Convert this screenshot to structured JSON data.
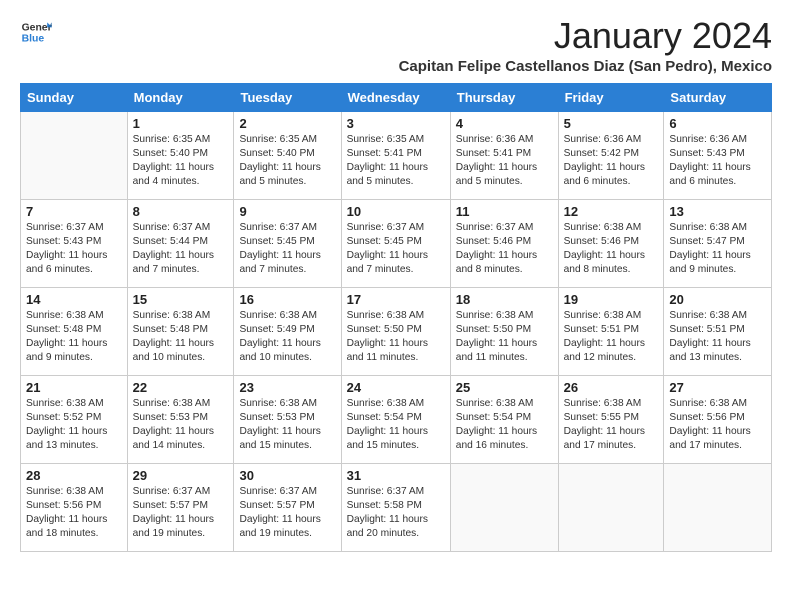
{
  "header": {
    "logo_line1": "General",
    "logo_line2": "Blue",
    "main_title": "January 2024",
    "subtitle": "Capitan Felipe Castellanos Diaz (San Pedro), Mexico"
  },
  "calendar": {
    "days_of_week": [
      "Sunday",
      "Monday",
      "Tuesday",
      "Wednesday",
      "Thursday",
      "Friday",
      "Saturday"
    ],
    "weeks": [
      [
        {
          "day": "",
          "info": ""
        },
        {
          "day": "1",
          "info": "Sunrise: 6:35 AM\nSunset: 5:40 PM\nDaylight: 11 hours\nand 4 minutes."
        },
        {
          "day": "2",
          "info": "Sunrise: 6:35 AM\nSunset: 5:40 PM\nDaylight: 11 hours\nand 5 minutes."
        },
        {
          "day": "3",
          "info": "Sunrise: 6:35 AM\nSunset: 5:41 PM\nDaylight: 11 hours\nand 5 minutes."
        },
        {
          "day": "4",
          "info": "Sunrise: 6:36 AM\nSunset: 5:41 PM\nDaylight: 11 hours\nand 5 minutes."
        },
        {
          "day": "5",
          "info": "Sunrise: 6:36 AM\nSunset: 5:42 PM\nDaylight: 11 hours\nand 6 minutes."
        },
        {
          "day": "6",
          "info": "Sunrise: 6:36 AM\nSunset: 5:43 PM\nDaylight: 11 hours\nand 6 minutes."
        }
      ],
      [
        {
          "day": "7",
          "info": "Sunrise: 6:37 AM\nSunset: 5:43 PM\nDaylight: 11 hours\nand 6 minutes."
        },
        {
          "day": "8",
          "info": "Sunrise: 6:37 AM\nSunset: 5:44 PM\nDaylight: 11 hours\nand 7 minutes."
        },
        {
          "day": "9",
          "info": "Sunrise: 6:37 AM\nSunset: 5:45 PM\nDaylight: 11 hours\nand 7 minutes."
        },
        {
          "day": "10",
          "info": "Sunrise: 6:37 AM\nSunset: 5:45 PM\nDaylight: 11 hours\nand 7 minutes."
        },
        {
          "day": "11",
          "info": "Sunrise: 6:37 AM\nSunset: 5:46 PM\nDaylight: 11 hours\nand 8 minutes."
        },
        {
          "day": "12",
          "info": "Sunrise: 6:38 AM\nSunset: 5:46 PM\nDaylight: 11 hours\nand 8 minutes."
        },
        {
          "day": "13",
          "info": "Sunrise: 6:38 AM\nSunset: 5:47 PM\nDaylight: 11 hours\nand 9 minutes."
        }
      ],
      [
        {
          "day": "14",
          "info": "Sunrise: 6:38 AM\nSunset: 5:48 PM\nDaylight: 11 hours\nand 9 minutes."
        },
        {
          "day": "15",
          "info": "Sunrise: 6:38 AM\nSunset: 5:48 PM\nDaylight: 11 hours\nand 10 minutes."
        },
        {
          "day": "16",
          "info": "Sunrise: 6:38 AM\nSunset: 5:49 PM\nDaylight: 11 hours\nand 10 minutes."
        },
        {
          "day": "17",
          "info": "Sunrise: 6:38 AM\nSunset: 5:50 PM\nDaylight: 11 hours\nand 11 minutes."
        },
        {
          "day": "18",
          "info": "Sunrise: 6:38 AM\nSunset: 5:50 PM\nDaylight: 11 hours\nand 11 minutes."
        },
        {
          "day": "19",
          "info": "Sunrise: 6:38 AM\nSunset: 5:51 PM\nDaylight: 11 hours\nand 12 minutes."
        },
        {
          "day": "20",
          "info": "Sunrise: 6:38 AM\nSunset: 5:51 PM\nDaylight: 11 hours\nand 13 minutes."
        }
      ],
      [
        {
          "day": "21",
          "info": "Sunrise: 6:38 AM\nSunset: 5:52 PM\nDaylight: 11 hours\nand 13 minutes."
        },
        {
          "day": "22",
          "info": "Sunrise: 6:38 AM\nSunset: 5:53 PM\nDaylight: 11 hours\nand 14 minutes."
        },
        {
          "day": "23",
          "info": "Sunrise: 6:38 AM\nSunset: 5:53 PM\nDaylight: 11 hours\nand 15 minutes."
        },
        {
          "day": "24",
          "info": "Sunrise: 6:38 AM\nSunset: 5:54 PM\nDaylight: 11 hours\nand 15 minutes."
        },
        {
          "day": "25",
          "info": "Sunrise: 6:38 AM\nSunset: 5:54 PM\nDaylight: 11 hours\nand 16 minutes."
        },
        {
          "day": "26",
          "info": "Sunrise: 6:38 AM\nSunset: 5:55 PM\nDaylight: 11 hours\nand 17 minutes."
        },
        {
          "day": "27",
          "info": "Sunrise: 6:38 AM\nSunset: 5:56 PM\nDaylight: 11 hours\nand 17 minutes."
        }
      ],
      [
        {
          "day": "28",
          "info": "Sunrise: 6:38 AM\nSunset: 5:56 PM\nDaylight: 11 hours\nand 18 minutes."
        },
        {
          "day": "29",
          "info": "Sunrise: 6:37 AM\nSunset: 5:57 PM\nDaylight: 11 hours\nand 19 minutes."
        },
        {
          "day": "30",
          "info": "Sunrise: 6:37 AM\nSunset: 5:57 PM\nDaylight: 11 hours\nand 19 minutes."
        },
        {
          "day": "31",
          "info": "Sunrise: 6:37 AM\nSunset: 5:58 PM\nDaylight: 11 hours\nand 20 minutes."
        },
        {
          "day": "",
          "info": ""
        },
        {
          "day": "",
          "info": ""
        },
        {
          "day": "",
          "info": ""
        }
      ]
    ]
  }
}
